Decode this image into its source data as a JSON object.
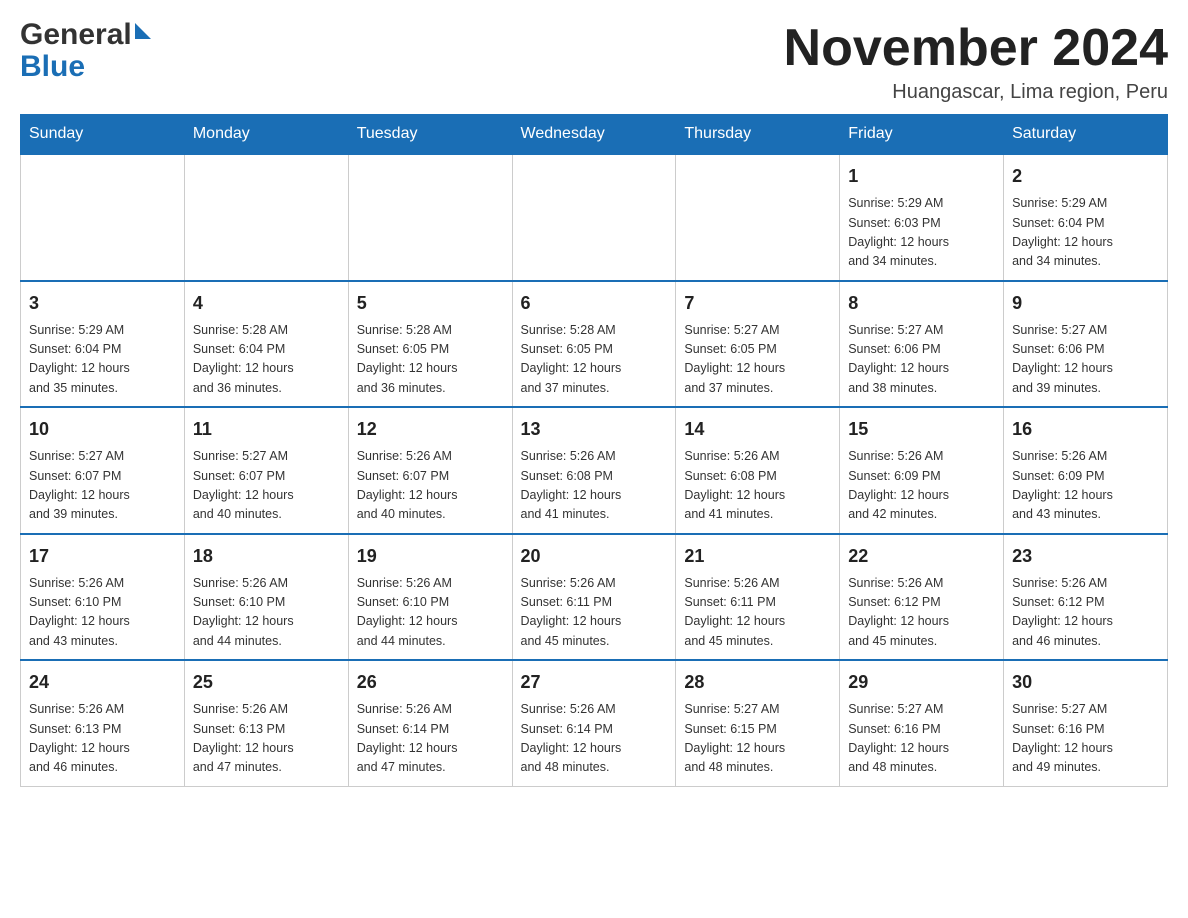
{
  "header": {
    "logo": {
      "general": "General",
      "blue": "Blue"
    },
    "title": "November 2024",
    "subtitle": "Huangascar, Lima region, Peru"
  },
  "weekdays": [
    "Sunday",
    "Monday",
    "Tuesday",
    "Wednesday",
    "Thursday",
    "Friday",
    "Saturday"
  ],
  "weeks": [
    [
      {
        "day": "",
        "info": ""
      },
      {
        "day": "",
        "info": ""
      },
      {
        "day": "",
        "info": ""
      },
      {
        "day": "",
        "info": ""
      },
      {
        "day": "",
        "info": ""
      },
      {
        "day": "1",
        "info": "Sunrise: 5:29 AM\nSunset: 6:03 PM\nDaylight: 12 hours\nand 34 minutes."
      },
      {
        "day": "2",
        "info": "Sunrise: 5:29 AM\nSunset: 6:04 PM\nDaylight: 12 hours\nand 34 minutes."
      }
    ],
    [
      {
        "day": "3",
        "info": "Sunrise: 5:29 AM\nSunset: 6:04 PM\nDaylight: 12 hours\nand 35 minutes."
      },
      {
        "day": "4",
        "info": "Sunrise: 5:28 AM\nSunset: 6:04 PM\nDaylight: 12 hours\nand 36 minutes."
      },
      {
        "day": "5",
        "info": "Sunrise: 5:28 AM\nSunset: 6:05 PM\nDaylight: 12 hours\nand 36 minutes."
      },
      {
        "day": "6",
        "info": "Sunrise: 5:28 AM\nSunset: 6:05 PM\nDaylight: 12 hours\nand 37 minutes."
      },
      {
        "day": "7",
        "info": "Sunrise: 5:27 AM\nSunset: 6:05 PM\nDaylight: 12 hours\nand 37 minutes."
      },
      {
        "day": "8",
        "info": "Sunrise: 5:27 AM\nSunset: 6:06 PM\nDaylight: 12 hours\nand 38 minutes."
      },
      {
        "day": "9",
        "info": "Sunrise: 5:27 AM\nSunset: 6:06 PM\nDaylight: 12 hours\nand 39 minutes."
      }
    ],
    [
      {
        "day": "10",
        "info": "Sunrise: 5:27 AM\nSunset: 6:07 PM\nDaylight: 12 hours\nand 39 minutes."
      },
      {
        "day": "11",
        "info": "Sunrise: 5:27 AM\nSunset: 6:07 PM\nDaylight: 12 hours\nand 40 minutes."
      },
      {
        "day": "12",
        "info": "Sunrise: 5:26 AM\nSunset: 6:07 PM\nDaylight: 12 hours\nand 40 minutes."
      },
      {
        "day": "13",
        "info": "Sunrise: 5:26 AM\nSunset: 6:08 PM\nDaylight: 12 hours\nand 41 minutes."
      },
      {
        "day": "14",
        "info": "Sunrise: 5:26 AM\nSunset: 6:08 PM\nDaylight: 12 hours\nand 41 minutes."
      },
      {
        "day": "15",
        "info": "Sunrise: 5:26 AM\nSunset: 6:09 PM\nDaylight: 12 hours\nand 42 minutes."
      },
      {
        "day": "16",
        "info": "Sunrise: 5:26 AM\nSunset: 6:09 PM\nDaylight: 12 hours\nand 43 minutes."
      }
    ],
    [
      {
        "day": "17",
        "info": "Sunrise: 5:26 AM\nSunset: 6:10 PM\nDaylight: 12 hours\nand 43 minutes."
      },
      {
        "day": "18",
        "info": "Sunrise: 5:26 AM\nSunset: 6:10 PM\nDaylight: 12 hours\nand 44 minutes."
      },
      {
        "day": "19",
        "info": "Sunrise: 5:26 AM\nSunset: 6:10 PM\nDaylight: 12 hours\nand 44 minutes."
      },
      {
        "day": "20",
        "info": "Sunrise: 5:26 AM\nSunset: 6:11 PM\nDaylight: 12 hours\nand 45 minutes."
      },
      {
        "day": "21",
        "info": "Sunrise: 5:26 AM\nSunset: 6:11 PM\nDaylight: 12 hours\nand 45 minutes."
      },
      {
        "day": "22",
        "info": "Sunrise: 5:26 AM\nSunset: 6:12 PM\nDaylight: 12 hours\nand 45 minutes."
      },
      {
        "day": "23",
        "info": "Sunrise: 5:26 AM\nSunset: 6:12 PM\nDaylight: 12 hours\nand 46 minutes."
      }
    ],
    [
      {
        "day": "24",
        "info": "Sunrise: 5:26 AM\nSunset: 6:13 PM\nDaylight: 12 hours\nand 46 minutes."
      },
      {
        "day": "25",
        "info": "Sunrise: 5:26 AM\nSunset: 6:13 PM\nDaylight: 12 hours\nand 47 minutes."
      },
      {
        "day": "26",
        "info": "Sunrise: 5:26 AM\nSunset: 6:14 PM\nDaylight: 12 hours\nand 47 minutes."
      },
      {
        "day": "27",
        "info": "Sunrise: 5:26 AM\nSunset: 6:14 PM\nDaylight: 12 hours\nand 48 minutes."
      },
      {
        "day": "28",
        "info": "Sunrise: 5:27 AM\nSunset: 6:15 PM\nDaylight: 12 hours\nand 48 minutes."
      },
      {
        "day": "29",
        "info": "Sunrise: 5:27 AM\nSunset: 6:16 PM\nDaylight: 12 hours\nand 48 minutes."
      },
      {
        "day": "30",
        "info": "Sunrise: 5:27 AM\nSunset: 6:16 PM\nDaylight: 12 hours\nand 49 minutes."
      }
    ]
  ]
}
